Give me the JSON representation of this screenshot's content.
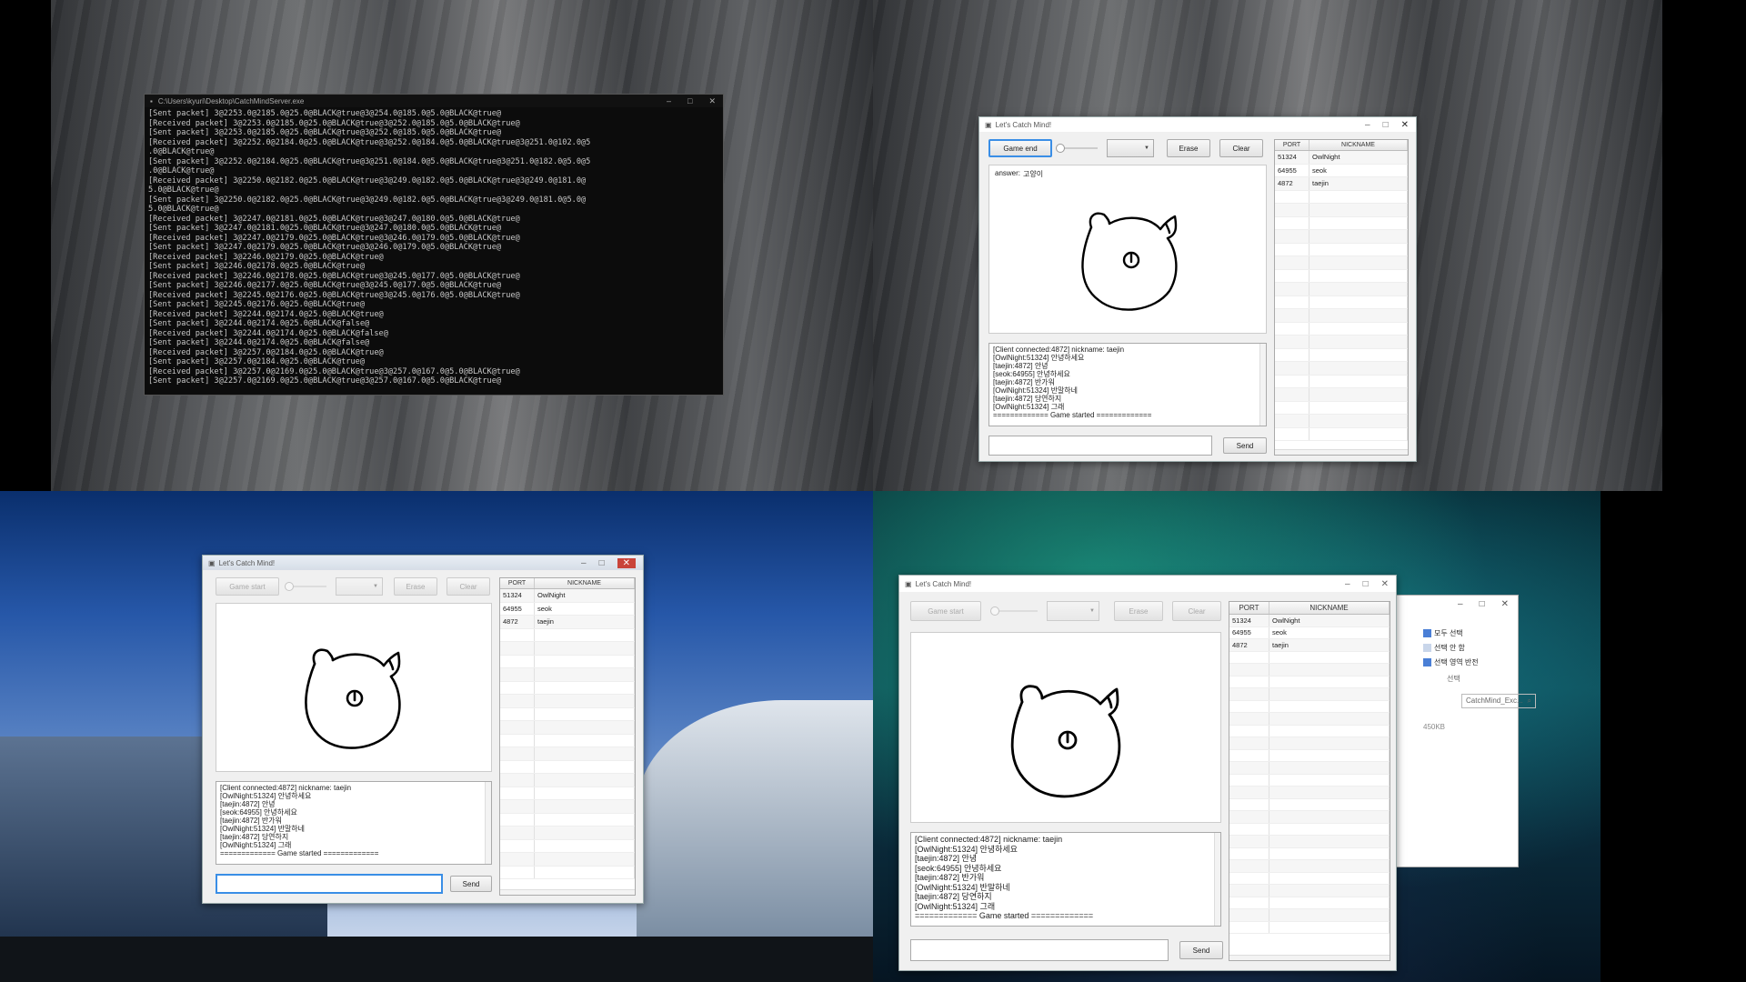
{
  "server_console": {
    "title": "C:\\Users\\kyuri\\Desktop\\CatchMindServer.exe",
    "lines": [
      "[Sent packet] 3@2253.0@2185.0@25.0@BLACK@true@3@254.0@185.0@5.0@BLACK@true@",
      "[Received packet] 3@2253.0@2185.0@25.0@BLACK@true@3@252.0@185.0@5.0@BLACK@true@",
      "[Sent packet] 3@2253.0@2185.0@25.0@BLACK@true@3@252.0@185.0@5.0@BLACK@true@",
      "[Received packet] 3@2252.0@2184.0@25.0@BLACK@true@3@252.0@184.0@5.0@BLACK@true@3@251.0@102.0@5",
      ".0@BLACK@true@",
      "[Sent packet] 3@2252.0@2184.0@25.0@BLACK@true@3@251.0@184.0@5.0@BLACK@true@3@251.0@182.0@5.0@5",
      ".0@BLACK@true@",
      "[Received packet] 3@2250.0@2182.0@25.0@BLACK@true@3@249.0@182.0@5.0@BLACK@true@3@249.0@181.0@",
      "5.0@BLACK@true@",
      "[Sent packet] 3@2250.0@2182.0@25.0@BLACK@true@3@249.0@182.0@5.0@BLACK@true@3@249.0@181.0@5.0@",
      "5.0@BLACK@true@",
      "[Received packet] 3@2247.0@2181.0@25.0@BLACK@true@3@247.0@180.0@5.0@BLACK@true@",
      "[Sent packet] 3@2247.0@2181.0@25.0@BLACK@true@3@247.0@180.0@5.0@BLACK@true@",
      "[Received packet] 3@2247.0@2179.0@25.0@BLACK@true@3@246.0@179.0@5.0@BLACK@true@",
      "[Sent packet] 3@2247.0@2179.0@25.0@BLACK@true@3@246.0@179.0@5.0@BLACK@true@",
      "[Received packet] 3@2246.0@2179.0@25.0@BLACK@true@",
      "[Sent packet] 3@2246.0@2178.0@25.0@BLACK@true@",
      "[Received packet] 3@2246.0@2178.0@25.0@BLACK@true@3@245.0@177.0@5.0@BLACK@true@",
      "[Sent packet] 3@2246.0@2177.0@25.0@BLACK@true@3@245.0@177.0@5.0@BLACK@true@",
      "[Received packet] 3@2245.0@2176.0@25.0@BLACK@true@3@245.0@176.0@5.0@BLACK@true@",
      "[Sent packet] 3@2245.0@2176.0@25.0@BLACK@true@",
      "[Received packet] 3@2244.0@2174.0@25.0@BLACK@true@",
      "[Sent packet] 3@2244.0@2174.0@25.0@BLACK@false@",
      "[Received packet] 3@2244.0@2174.0@25.0@BLACK@false@",
      "[Sent packet] 3@2244.0@2174.0@25.0@BLACK@false@",
      "[Received packet] 3@2257.0@2184.0@25.0@BLACK@true@",
      "[Sent packet] 3@2257.0@2184.0@25.0@BLACK@true@",
      "[Received packet] 3@2257.0@2169.0@25.0@BLACK@true@3@257.0@167.0@5.0@BLACK@true@",
      "[Sent packet] 3@2257.0@2169.0@25.0@BLACK@true@3@257.0@167.0@5.0@BLACK@true@"
    ]
  },
  "app": {
    "title": "Let's Catch Mind!",
    "btn_game_end": "Game end",
    "btn_game_start": "Game start",
    "btn_erase": "Erase",
    "btn_clear": "Clear",
    "btn_send": "Send",
    "answer_label": "answer:",
    "answer_value": "고양이",
    "table_headers": [
      "PORT",
      "NICKNAME"
    ],
    "players": [
      {
        "port": "51324",
        "nickname": "OwlNight"
      },
      {
        "port": "64955",
        "nickname": "seok"
      },
      {
        "port": "4872",
        "nickname": "taejin"
      }
    ],
    "chat_lines": [
      "[Client connected:4872] nickname: taejin",
      "[OwlNight:51324] 안녕하세요",
      "[taejin:4872] 안녕",
      "[seok:64955] 안녕하세요",
      "[taejin:4872] 반가워",
      "[OwlNight:51324] 반말하네",
      "[taejin:4872] 당연하지",
      "[OwlNight:51324] 그래",
      "============= Game started ============="
    ]
  },
  "explorer": {
    "select_all": "모두 선택",
    "select_none": "선택 안 함",
    "invert_selection": "선택 영역 반전",
    "group_label": "선택",
    "search_placeholder": "CatchMind_Exc...",
    "file_size": "450KB"
  }
}
